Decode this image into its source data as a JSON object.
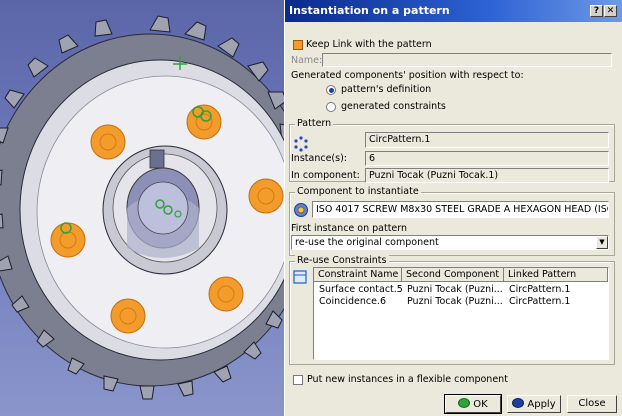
{
  "dialog": {
    "title": "Instantiation on a pattern",
    "help_glyph": "?",
    "close_glyph": "✕",
    "keep_link_label": "Keep Link with the pattern",
    "keep_link_checked": true,
    "name_label": "Name:",
    "name_value": "",
    "position_prompt": "Generated components' position with respect to:",
    "position_options": [
      {
        "label": "pattern's definition",
        "selected": true
      },
      {
        "label": "generated constraints",
        "selected": false
      }
    ],
    "pattern_group": {
      "title": "Pattern",
      "pattern_name": "CircPattern.1",
      "instances_label": "Instance(s):",
      "instances_value": "6",
      "in_component_label": "In component:",
      "in_component_value": "Puzni Tocak (Puzni Tocak.1)"
    },
    "component_group": {
      "title": "Component to instantiate",
      "component_value": "ISO 4017 SCREW M8x30 STEEL GRADE A HEXAGON HEAD (ISO -",
      "first_instance_label": "First instance on pattern",
      "first_instance_value": "re-use the original component"
    },
    "reuse_group": {
      "title": "Re-use Constraints",
      "columns": [
        "Constraint Name",
        "Second Component",
        "Linked Pattern"
      ],
      "rows": [
        [
          "Surface contact.5",
          "Puzni Tocak (Puzni...",
          "CircPattern.1"
        ],
        [
          "Coincidence.6",
          "Puzni Tocak (Puzni...",
          "CircPattern.1"
        ]
      ]
    },
    "flexible_label": "Put new instances in a flexible component",
    "flexible_checked": false,
    "ok_label": "OK",
    "apply_label": "Apply",
    "close_label": "Close"
  },
  "colors": {
    "background_gradient_top": "#5a66a8",
    "gear_face": "#e8e8ee",
    "bolt_orange": "#f39c2c",
    "title_bar": "#0a2a8c",
    "dialog_bg": "#ebe8dc"
  },
  "icons": {
    "pattern": "circular-pattern-icon",
    "component": "component-icon",
    "reuse_constraints": "constraint-table-icon",
    "ok": "ok-icon",
    "apply": "apply-icon"
  }
}
